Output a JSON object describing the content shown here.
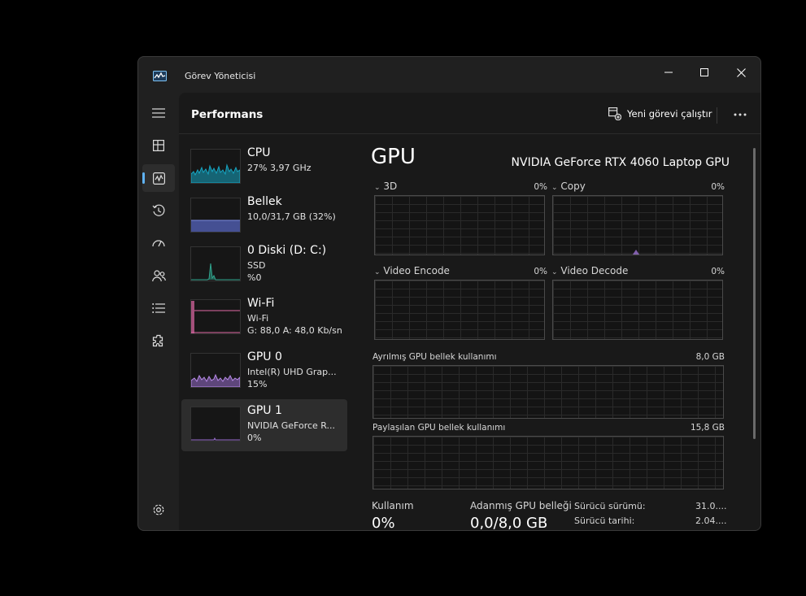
{
  "window": {
    "title": "Görev Yöneticisi"
  },
  "header": {
    "page_title": "Performans",
    "run_task_label": "Yeni görevi çalıştır"
  },
  "nav": {
    "items": [
      "menu-icon",
      "processes-icon",
      "performance-icon",
      "app-history-icon",
      "startup-icon",
      "users-icon",
      "details-icon",
      "services-icon"
    ],
    "active": "performance-icon",
    "settings": "settings-icon"
  },
  "devices": [
    {
      "name": "CPU",
      "sub1": "27% 3,97 GHz",
      "sub2": "",
      "sub3": "",
      "color": "#16a5c2"
    },
    {
      "name": "Bellek",
      "sub1": "10,0/31,7 GB (32%)",
      "sub2": "",
      "sub3": "",
      "color": "#5a6ac9"
    },
    {
      "name": "0 Diski (D: C:)",
      "sub1": "SSD",
      "sub2": "%0",
      "sub3": "",
      "color": "#30a58e"
    },
    {
      "name": "Wi-Fi",
      "sub1": "Wi-Fi",
      "sub2": "G: 88,0 A: 48,0 Kb/sn",
      "sub3": "",
      "color": "#e169a7"
    },
    {
      "name": "GPU 0",
      "sub1": "Intel(R) UHD Grap...",
      "sub2": "15%",
      "sub3": "",
      "color": "#9a6fd0"
    },
    {
      "name": "GPU 1",
      "sub1": "NVIDIA GeForce R...",
      "sub2": "0%",
      "sub3": "",
      "color": "#9a6fd0"
    }
  ],
  "detail": {
    "title": "GPU",
    "model": "NVIDIA GeForce RTX 4060 Laptop GPU",
    "engines": [
      {
        "label": "3D",
        "value": "0%"
      },
      {
        "label": "Copy",
        "value": "0%"
      },
      {
        "label": "Video Encode",
        "value": "0%"
      },
      {
        "label": "Video Decode",
        "value": "0%"
      }
    ],
    "dedicated_mem": {
      "label": "Ayrılmış GPU bellek kullanımı",
      "value": "8,0 GB"
    },
    "shared_mem": {
      "label": "Paylaşılan GPU bellek kullanımı",
      "value": "15,8 GB"
    },
    "stats": {
      "usage_label": "Kullanım",
      "usage_value": "0%",
      "dedicated_label": "Adanmış GPU belleği",
      "dedicated_value": "0,0/8,0 GB"
    },
    "kv": [
      {
        "key": "Sürücü sürümü:",
        "value": "31.0...."
      },
      {
        "key": "Sürücü tarihi:",
        "value": "2.04...."
      }
    ]
  }
}
